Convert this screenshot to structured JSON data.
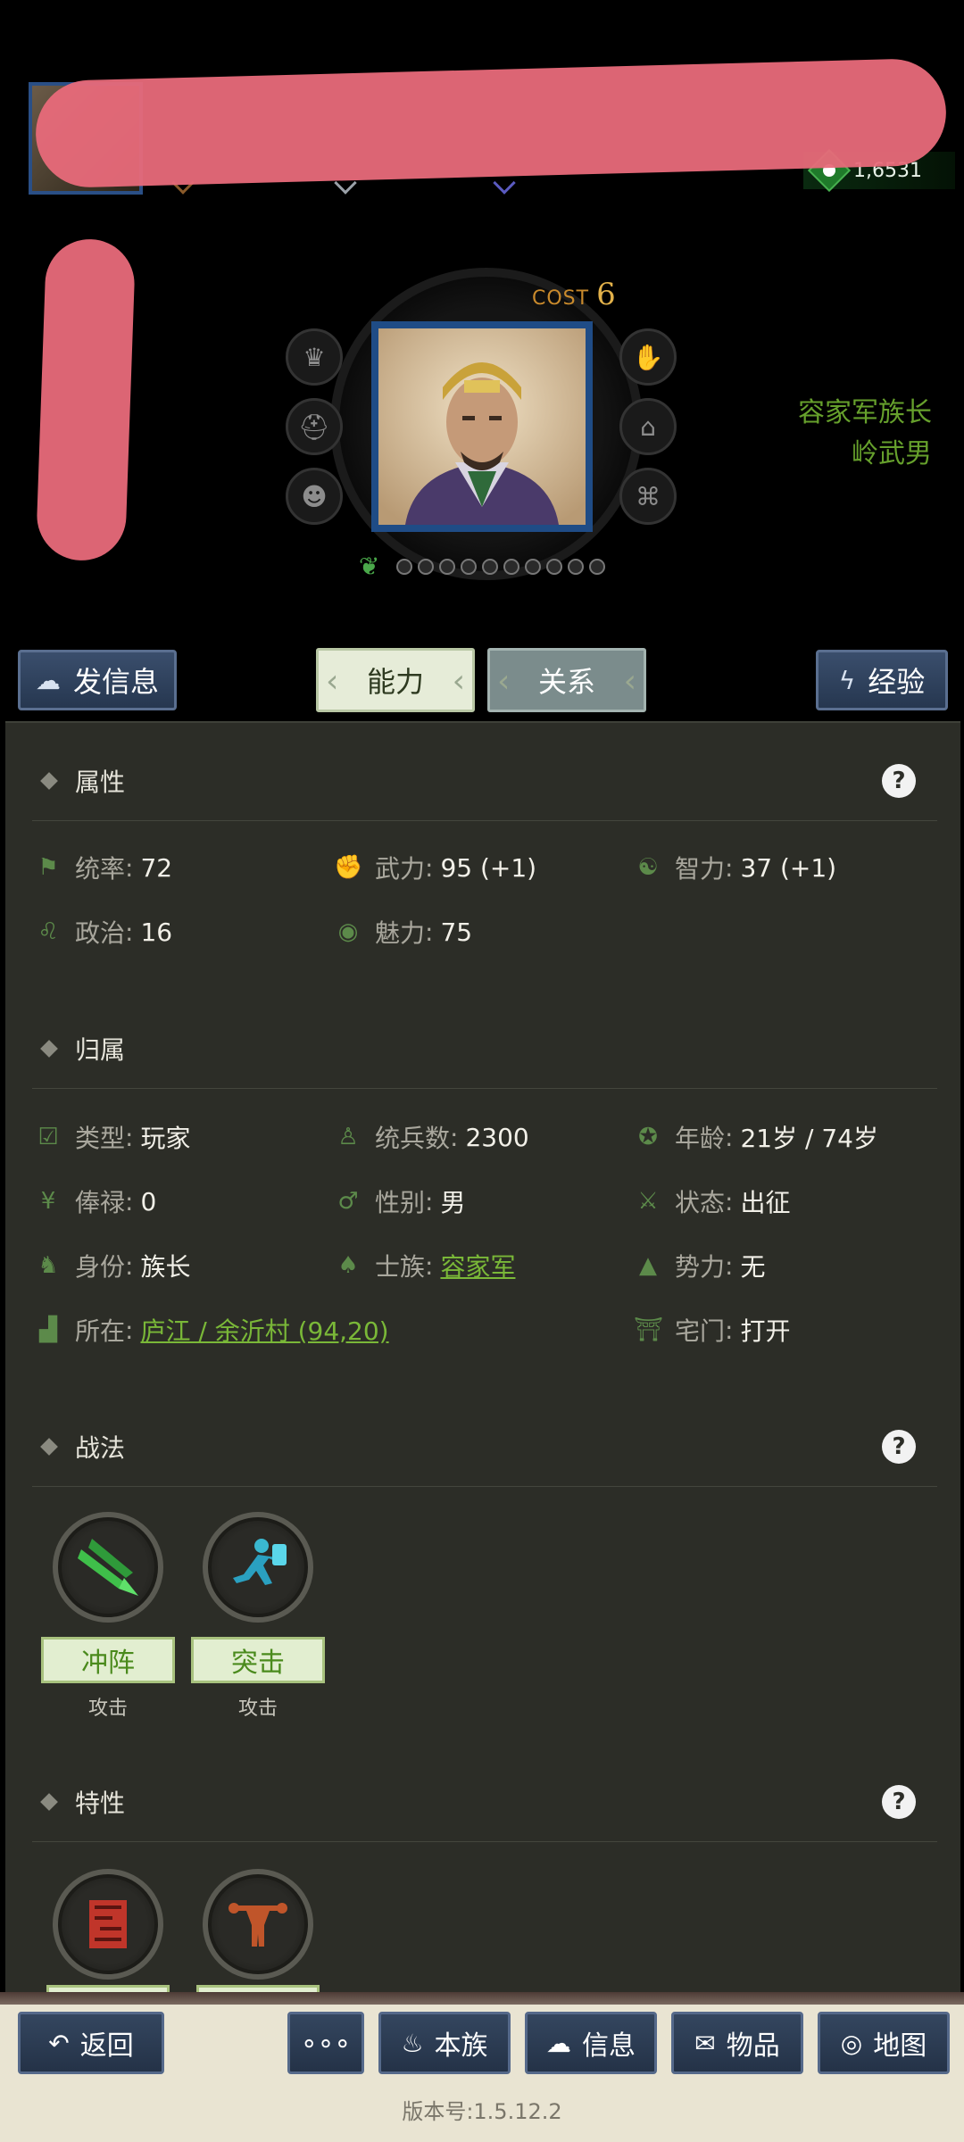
{
  "header": {
    "currency_value": "1,6531",
    "cost_label": "COST",
    "cost_value": "6"
  },
  "character": {
    "titles": [
      "容家军族长",
      "岭武男"
    ],
    "stars_total": 10,
    "left_icons": [
      "crown-icon",
      "helmet-icon",
      "mask-icon"
    ],
    "right_icons": [
      "hand-icon",
      "hat-icon",
      "graduation-cap-icon"
    ]
  },
  "actions": {
    "send_message": "发信息",
    "tab_ability": "能力",
    "tab_relation": "关系",
    "experience": "经验"
  },
  "sections": {
    "attributes": "属性",
    "affiliation": "归属",
    "tactics": "战法",
    "traits": "特性",
    "help": "?"
  },
  "attributes": [
    {
      "icon": "flag-icon",
      "key": "统率",
      "value": "72"
    },
    {
      "icon": "arm-icon",
      "key": "武力",
      "value": "95 (+1)"
    },
    {
      "icon": "brain-icon",
      "key": "智力",
      "value": "37 (+1)"
    },
    {
      "icon": "bag-icon",
      "key": "政治",
      "value": "16"
    },
    {
      "icon": "eye-icon",
      "key": "魅力",
      "value": "75"
    }
  ],
  "affiliation": [
    {
      "icon": "calendar-check-icon",
      "key": "类型",
      "value": "玩家"
    },
    {
      "icon": "soldier-icon",
      "key": "统兵数",
      "value": "2300"
    },
    {
      "icon": "age-icon",
      "key": "年龄",
      "value": "21岁 / 74岁"
    },
    {
      "icon": "yen-icon",
      "key": "俸禄",
      "value": "0"
    },
    {
      "icon": "gender-icon",
      "key": "性别",
      "value": "男"
    },
    {
      "icon": "status-icon",
      "key": "状态",
      "value": "出征"
    },
    {
      "icon": "identity-icon",
      "key": "身份",
      "value": "族长"
    },
    {
      "icon": "clan-icon",
      "key": "士族",
      "value": "容家军"
    },
    {
      "icon": "power-icon",
      "key": "势力",
      "value": "无"
    },
    {
      "icon": "location-icon",
      "key": "所在",
      "value": "庐江 / 余沂村 (94,20)"
    },
    {
      "icon": "gate-icon",
      "key": "宅门",
      "value": "打开"
    }
  ],
  "tactics": [
    {
      "name": "冲阵",
      "type": "攻击"
    },
    {
      "name": "突击",
      "type": "攻击"
    }
  ],
  "bottom_nav": {
    "back": "返回",
    "more": "∘∘∘",
    "clan": "本族",
    "info": "信息",
    "items": "物品",
    "map": "地图"
  },
  "version": "版本号:1.5.12.2"
}
